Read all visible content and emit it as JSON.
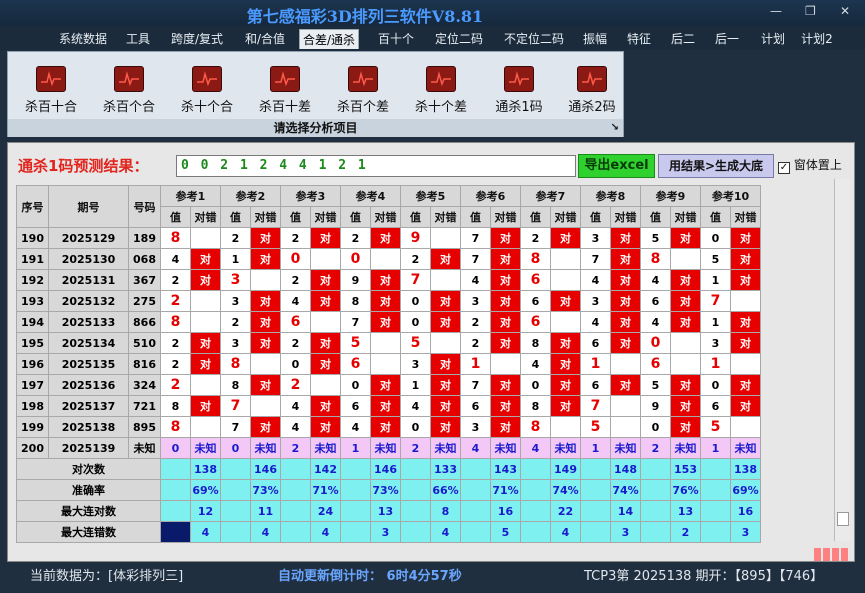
{
  "window": {
    "title": "第七感福彩3D排列三软件V8.81",
    "min": "—",
    "max": "❐",
    "close": "✕"
  },
  "menu": [
    "系统数据",
    "工具",
    "跨度/复式",
    "和/合值",
    "合差/通杀",
    "百十个",
    "定位二码",
    "不定位二码",
    "振幅",
    "特征",
    "后二",
    "后一",
    "计划",
    "计划2"
  ],
  "active_menu_index": 4,
  "ribbon": {
    "buttons": [
      "杀百十合",
      "杀百个合",
      "杀十个合",
      "杀百十差",
      "杀百个差",
      "杀十个差",
      "通杀1码",
      "通杀2码"
    ],
    "footer": "请选择分析项目",
    "corner": "↘"
  },
  "prediction": {
    "label": "通杀1码预测结果：",
    "value": "0 0 2 1 2 4 4 1 2 1"
  },
  "export_btn": "导出excel",
  "generate_btn": "用结果>生成大底",
  "topmost": {
    "label": "窗体置上",
    "checked": "✓"
  },
  "table": {
    "col_seq": "序号",
    "col_issue": "期号",
    "col_num": "号码",
    "refs": [
      "参考1",
      "参考2",
      "参考3",
      "参考4",
      "参考5",
      "参考6",
      "参考7",
      "参考8",
      "参考9",
      "参考10"
    ],
    "sub_val": "值",
    "sub_ok": "对错",
    "mark_hit": "对",
    "rows": [
      {
        "seq": "190",
        "issue": "2025129",
        "num": "189",
        "cells": [
          [
            "8",
            "",
            0
          ],
          [
            "2",
            "对",
            1
          ],
          [
            "2",
            "对",
            1
          ],
          [
            "2",
            "对",
            1
          ],
          [
            "9",
            "",
            0
          ],
          [
            "7",
            "对",
            1
          ],
          [
            "2",
            "对",
            1
          ],
          [
            "3",
            "对",
            1
          ],
          [
            "5",
            "对",
            1
          ],
          [
            "0",
            "对",
            1
          ]
        ]
      },
      {
        "seq": "191",
        "issue": "2025130",
        "num": "068",
        "cells": [
          [
            "4",
            "对",
            1
          ],
          [
            "1",
            "对",
            1
          ],
          [
            "0",
            "",
            0
          ],
          [
            "0",
            "",
            0
          ],
          [
            "2",
            "对",
            1
          ],
          [
            "7",
            "对",
            1
          ],
          [
            "8",
            "",
            0
          ],
          [
            "7",
            "对",
            1
          ],
          [
            "8",
            "",
            0
          ],
          [
            "5",
            "对",
            1
          ]
        ]
      },
      {
        "seq": "192",
        "issue": "2025131",
        "num": "367",
        "cells": [
          [
            "2",
            "对",
            1
          ],
          [
            "3",
            "",
            0
          ],
          [
            "2",
            "对",
            1
          ],
          [
            "9",
            "对",
            1
          ],
          [
            "7",
            "",
            0
          ],
          [
            "4",
            "对",
            1
          ],
          [
            "6",
            "",
            0
          ],
          [
            "4",
            "对",
            1
          ],
          [
            "4",
            "对",
            1
          ],
          [
            "1",
            "对",
            1
          ]
        ]
      },
      {
        "seq": "193",
        "issue": "2025132",
        "num": "275",
        "cells": [
          [
            "2",
            "",
            0
          ],
          [
            "3",
            "对",
            1
          ],
          [
            "4",
            "对",
            1
          ],
          [
            "8",
            "对",
            1
          ],
          [
            "0",
            "对",
            1
          ],
          [
            "3",
            "对",
            1
          ],
          [
            "6",
            "对",
            1
          ],
          [
            "3",
            "对",
            1
          ],
          [
            "6",
            "对",
            1
          ],
          [
            "7",
            "",
            0
          ]
        ]
      },
      {
        "seq": "194",
        "issue": "2025133",
        "num": "866",
        "cells": [
          [
            "8",
            "",
            0
          ],
          [
            "2",
            "对",
            1
          ],
          [
            "6",
            "",
            0
          ],
          [
            "7",
            "对",
            1
          ],
          [
            "0",
            "对",
            1
          ],
          [
            "2",
            "对",
            1
          ],
          [
            "6",
            "",
            0
          ],
          [
            "4",
            "对",
            1
          ],
          [
            "4",
            "对",
            1
          ],
          [
            "1",
            "对",
            1
          ]
        ]
      },
      {
        "seq": "195",
        "issue": "2025134",
        "num": "510",
        "cells": [
          [
            "2",
            "对",
            1
          ],
          [
            "3",
            "对",
            1
          ],
          [
            "2",
            "对",
            1
          ],
          [
            "5",
            "",
            0
          ],
          [
            "5",
            "",
            0
          ],
          [
            "2",
            "对",
            1
          ],
          [
            "8",
            "对",
            1
          ],
          [
            "6",
            "对",
            1
          ],
          [
            "0",
            "",
            0
          ],
          [
            "3",
            "对",
            1
          ]
        ]
      },
      {
        "seq": "196",
        "issue": "2025135",
        "num": "816",
        "cells": [
          [
            "2",
            "对",
            1
          ],
          [
            "8",
            "",
            0
          ],
          [
            "0",
            "对",
            1
          ],
          [
            "6",
            "",
            0
          ],
          [
            "3",
            "对",
            1
          ],
          [
            "1",
            "",
            0
          ],
          [
            "4",
            "对",
            1
          ],
          [
            "1",
            "",
            0
          ],
          [
            "6",
            "",
            0
          ],
          [
            "1",
            "",
            0
          ]
        ]
      },
      {
        "seq": "197",
        "issue": "2025136",
        "num": "324",
        "cells": [
          [
            "2",
            "",
            0
          ],
          [
            "8",
            "对",
            1
          ],
          [
            "2",
            "",
            0
          ],
          [
            "0",
            "对",
            1
          ],
          [
            "1",
            "对",
            1
          ],
          [
            "7",
            "对",
            1
          ],
          [
            "0",
            "对",
            1
          ],
          [
            "6",
            "对",
            1
          ],
          [
            "5",
            "对",
            1
          ],
          [
            "0",
            "对",
            1
          ]
        ]
      },
      {
        "seq": "198",
        "issue": "2025137",
        "num": "721",
        "cells": [
          [
            "8",
            "对",
            1
          ],
          [
            "7",
            "",
            0
          ],
          [
            "4",
            "对",
            1
          ],
          [
            "6",
            "对",
            1
          ],
          [
            "4",
            "对",
            1
          ],
          [
            "6",
            "对",
            1
          ],
          [
            "8",
            "对",
            1
          ],
          [
            "7",
            "",
            0
          ],
          [
            "9",
            "对",
            1
          ],
          [
            "6",
            "对",
            1
          ]
        ]
      },
      {
        "seq": "199",
        "issue": "2025138",
        "num": "895",
        "cells": [
          [
            "8",
            "",
            0
          ],
          [
            "7",
            "对",
            1
          ],
          [
            "4",
            "对",
            1
          ],
          [
            "4",
            "对",
            1
          ],
          [
            "0",
            "对",
            1
          ],
          [
            "3",
            "对",
            1
          ],
          [
            "8",
            "",
            0
          ],
          [
            "5",
            "",
            0
          ],
          [
            "0",
            "对",
            1
          ],
          [
            "5",
            "",
            0
          ]
        ]
      }
    ],
    "pending": {
      "seq": "200",
      "issue": "2025139",
      "num": "未知",
      "vals": [
        "0",
        "0",
        "2",
        "1",
        "2",
        "4",
        "4",
        "1",
        "2",
        "1"
      ],
      "unknown": "未知"
    },
    "stats": [
      {
        "label": "对次数",
        "vals": [
          "138",
          "146",
          "142",
          "146",
          "133",
          "143",
          "149",
          "148",
          "153",
          "138"
        ]
      },
      {
        "label": "准确率",
        "vals": [
          "69%",
          "73%",
          "71%",
          "73%",
          "66%",
          "71%",
          "74%",
          "74%",
          "76%",
          "69%"
        ]
      },
      {
        "label": "最大连对数",
        "vals": [
          "12",
          "11",
          "24",
          "13",
          "8",
          "16",
          "22",
          "14",
          "13",
          "16"
        ]
      },
      {
        "label": "最大连错数",
        "vals": [
          "4",
          "4",
          "4",
          "3",
          "4",
          "5",
          "4",
          "3",
          "2",
          "3"
        ]
      }
    ]
  },
  "status": {
    "current": "当前数据为：[体彩排列三]",
    "countdown": "自动更新倒计时： 6时4分57秒",
    "latest": "TCP3第 2025138 期开：【895】【746】"
  }
}
